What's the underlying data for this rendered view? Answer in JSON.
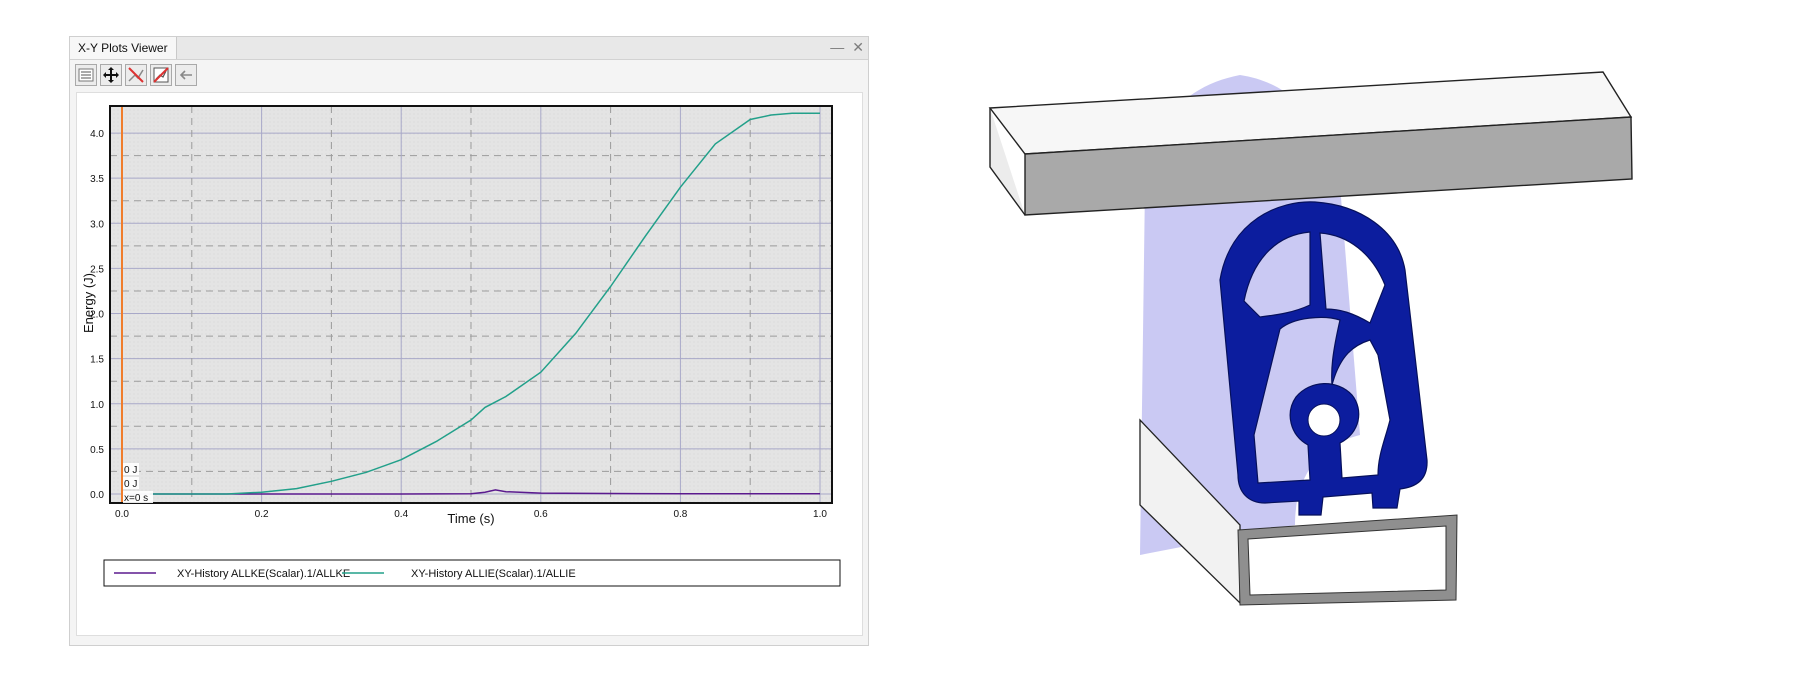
{
  "window": {
    "tab_label": "X-Y Plots Viewer",
    "controls": {
      "minimize_glyph": "—",
      "close_glyph": "✕"
    }
  },
  "toolbar": {
    "icons": [
      "legend-toggle-icon",
      "pan-move-icon",
      "clear-plot-icon",
      "delete-curve-icon",
      "back-arrow-icon"
    ]
  },
  "chart_data": {
    "type": "line",
    "xlabel": "Time (s)",
    "ylabel": "Energy (J)",
    "xlim": [
      0.0,
      1.0
    ],
    "ylim": [
      -0.1,
      4.3
    ],
    "x_ticks": [
      "0.0",
      "0.2",
      "0.4",
      "0.6",
      "0.8",
      "1.0"
    ],
    "y_ticks": [
      "0.0",
      "0.5",
      "1.0",
      "1.5",
      "2.0",
      "2.5",
      "3.0",
      "3.5",
      "4.0"
    ],
    "grid": true,
    "legend_placement": "bottom",
    "cursor": {
      "x": 0.0,
      "labels": [
        "0 J",
        "0 J",
        "x=0 s"
      ]
    },
    "series": [
      {
        "name": "XY-History ALLKE(Scalar).1/ALLKE",
        "color": "#5b1a8e",
        "x": [
          0.04,
          0.2,
          0.4,
          0.5,
          0.52,
          0.535,
          0.55,
          0.6,
          0.7,
          0.8,
          0.9,
          1.0
        ],
        "y": [
          0.0,
          0.0,
          0.0,
          0.003,
          0.02,
          0.045,
          0.025,
          0.01,
          0.005,
          0.003,
          0.002,
          0.002
        ]
      },
      {
        "name": "XY-History ALLIE(Scalar).1/ALLIE",
        "color": "#22a08a",
        "x": [
          0.04,
          0.1,
          0.15,
          0.2,
          0.25,
          0.3,
          0.35,
          0.4,
          0.45,
          0.5,
          0.52,
          0.55,
          0.6,
          0.65,
          0.7,
          0.75,
          0.8,
          0.85,
          0.9,
          0.93,
          0.96,
          1.0
        ],
        "y": [
          0.0,
          0.0,
          0.0,
          0.02,
          0.06,
          0.14,
          0.24,
          0.38,
          0.58,
          0.82,
          0.96,
          1.08,
          1.35,
          1.78,
          2.3,
          2.86,
          3.4,
          3.88,
          4.15,
          4.2,
          4.22,
          4.22
        ]
      }
    ]
  },
  "figure": {
    "colors": {
      "profile_blue": "#0c1d9e",
      "translucent_blue": "#b8b7ef",
      "beam_top": "#f7f7f7",
      "beam_side": "#a9a9a9",
      "channel": "#8f8f8f"
    }
  }
}
